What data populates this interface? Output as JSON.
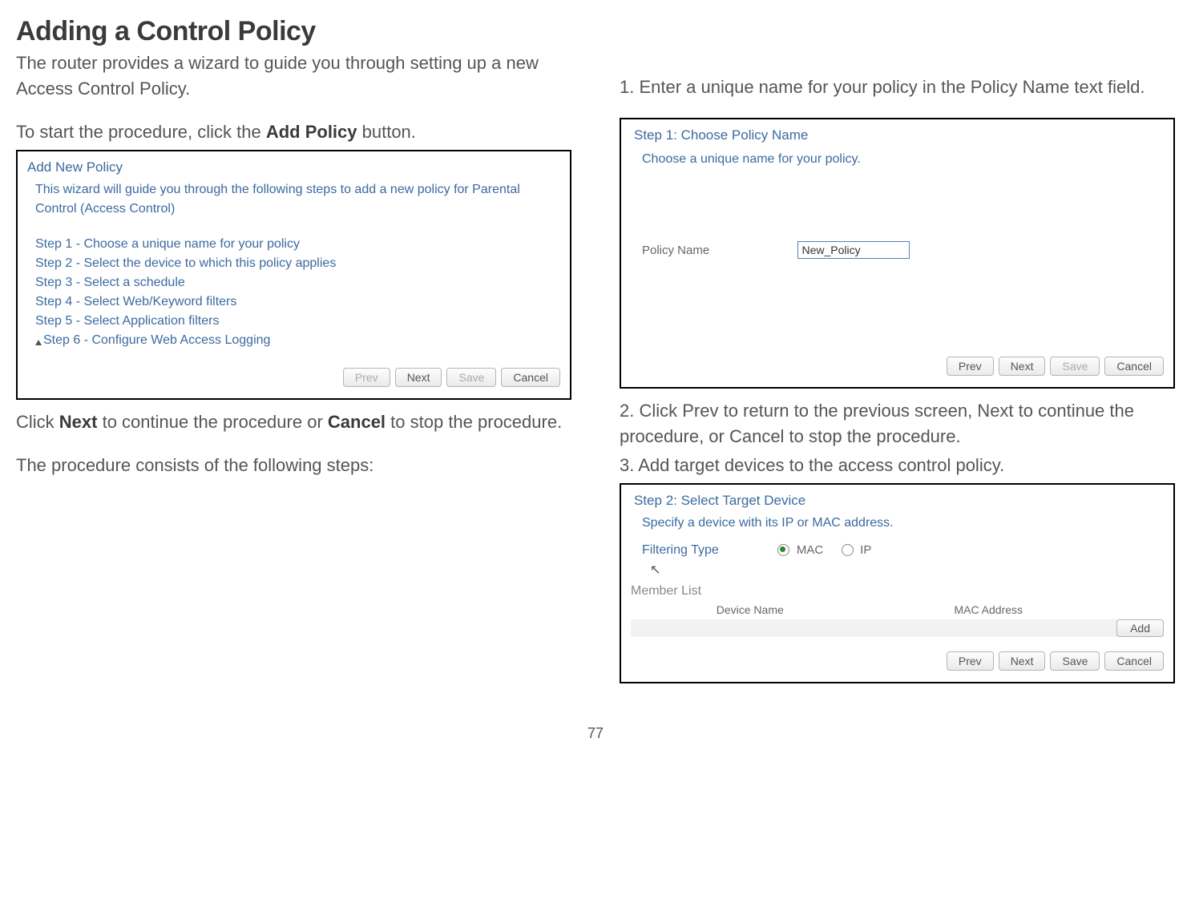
{
  "heading": "Adding a Control Policy",
  "left": {
    "intro": "The router provides a wizard to guide you through setting up a new Access Control Policy.",
    "start_pre": "To start the procedure, click the ",
    "start_bold": "Add Policy",
    "start_post": " button.",
    "fig1": {
      "title": "Add New Policy",
      "desc": "This wizard will guide you through the following steps to add a new policy for Parental Control (Access Control)",
      "steps": [
        "Step 1 - Choose a unique name for your policy",
        "Step 2 - Select the device to which this policy applies",
        "Step 3 - Select a schedule",
        "Step 4 - Select Web/Keyword filters",
        "Step 5 - Select Application filters",
        "Step 6 - Configure Web Access Logging"
      ],
      "buttons": {
        "prev": "Prev",
        "next": "Next",
        "save": "Save",
        "cancel": "Cancel"
      }
    },
    "after_fig_pre": "Click ",
    "after_fig_b1": "Next",
    "after_fig_mid": " to continue the procedure or ",
    "after_fig_b2": "Cancel",
    "after_fig_post": " to stop the procedure.",
    "consists": "The procedure consists of the following steps:"
  },
  "right": {
    "step1_text": "1. Enter a unique name for your policy in the Policy Name text field.",
    "fig2": {
      "title": "Step 1: Choose Policy Name",
      "subtitle": "Choose a unique name for your policy.",
      "label": "Policy Name",
      "value": "New_Policy",
      "buttons": {
        "prev": "Prev",
        "next": "Next",
        "save": "Save",
        "cancel": "Cancel"
      }
    },
    "step2_text": "2. Click Prev to return to the previous screen, Next to continue the procedure, or Cancel to stop the procedure.",
    "step3_text": "3. Add target devices to the access control policy.",
    "fig3": {
      "title": "Step 2: Select Target Device",
      "subtitle": "Specify a device with its IP or MAC address.",
      "filter_label": "Filtering Type",
      "mac": "MAC",
      "ip": "IP",
      "member": "Member List",
      "col1": "Device Name",
      "col2": "MAC Address",
      "add": "Add",
      "buttons": {
        "prev": "Prev",
        "next": "Next",
        "save": "Save",
        "cancel": "Cancel"
      }
    }
  },
  "page_number": "77"
}
